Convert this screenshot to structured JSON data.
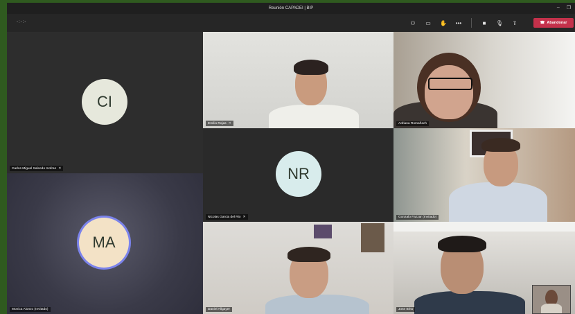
{
  "window": {
    "title": "Reunión CAPADEI | BIP",
    "minimize_glyph": "–",
    "restore_glyph": "❐"
  },
  "toolbar": {
    "timer": "-:-:-",
    "icons": [
      "participants-icon",
      "chat-icon",
      "raise-hand-icon",
      "more-icon",
      "camera-icon",
      "mic-off-icon",
      "share-icon"
    ],
    "icon_glyphs": {
      "participants": "⚇",
      "chat": "▭",
      "hand": "✋",
      "more": "•••",
      "camera": "■",
      "mic_off": "🎙",
      "share": "⇪",
      "phone": "☎"
    },
    "leave_label": "Abandonar",
    "leave_color": "#c4314b"
  },
  "participants": [
    {
      "name": "Carlos Miguel Salcedo Inofran",
      "initials": "CI",
      "muted": true,
      "avatar_color": "#e6e8dc"
    },
    {
      "name": "Emilio Rojas",
      "muted": true
    },
    {
      "name": "Adriana Romañach",
      "muted": false
    },
    {
      "name": "Nicolas Garcia del Rio",
      "initials": "NR",
      "muted": true,
      "avatar_color": "#d8ecec"
    },
    {
      "name": "Gonzalo Fazzar (Invitado)",
      "muted": false
    },
    {
      "name": "Monica Alonzo (Invitado)",
      "initials": "MA",
      "muted": false,
      "avatar_color": "#f3e2c6"
    },
    {
      "name": "Daniel Allgayer",
      "muted": false
    },
    {
      "name": "Jose Brito",
      "muted": false
    }
  ]
}
